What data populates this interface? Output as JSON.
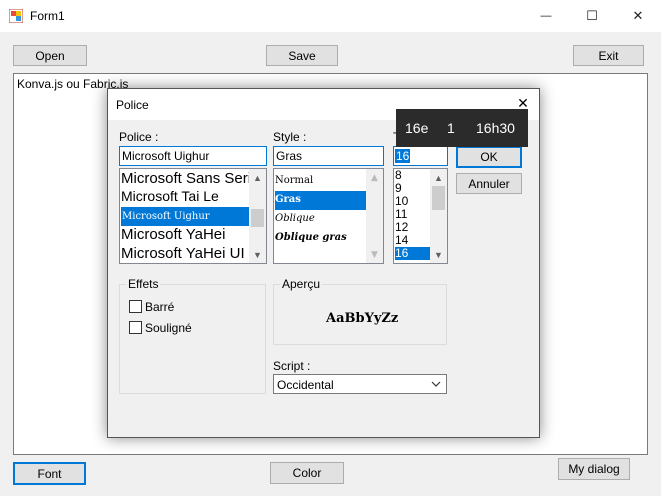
{
  "window": {
    "title": "Form1",
    "minimize_glyph": "—",
    "maximize_glyph": "☐",
    "close_glyph": "✕"
  },
  "toolbar": {
    "open_label": "Open",
    "save_label": "Save",
    "exit_label": "Exit"
  },
  "editor": {
    "text": "Konva.js ou Fabric.js"
  },
  "footer": {
    "font_label": "Font",
    "color_label": "Color",
    "mydialog_label": "My dialog"
  },
  "font_dialog": {
    "title": "Police",
    "close_glyph": "✕",
    "font_label": "Police :",
    "font_value": "Microsoft Uighur",
    "font_list": [
      "Microsoft Sans Serif",
      "Microsoft Tai Le",
      "Microsoft Uighur",
      "Microsoft YaHei",
      "Microsoft YaHei UI"
    ],
    "font_selected": "Microsoft Uighur",
    "style_label": "Style :",
    "style_value": "Gras",
    "style_list": [
      "Normal",
      "Gras",
      "Oblique",
      "Oblique gras"
    ],
    "style_selected": "Gras",
    "size_label": "T",
    "size_value": "16",
    "size_list": [
      "8",
      "9",
      "10",
      "11",
      "12",
      "14",
      "16"
    ],
    "size_selected": "16",
    "ok_label": "OK",
    "cancel_label": "Annuler",
    "effects_label": "Effets",
    "strike_label": "Barré",
    "underline_label": "Souligné",
    "preview_label": "Aperçu",
    "preview_text": "AaBbYyZz",
    "script_label": "Script :",
    "script_value": "Occidental",
    "accent_color": "#0078d7"
  },
  "tooltip": {
    "items": [
      "16e",
      "1",
      "16h30"
    ]
  }
}
